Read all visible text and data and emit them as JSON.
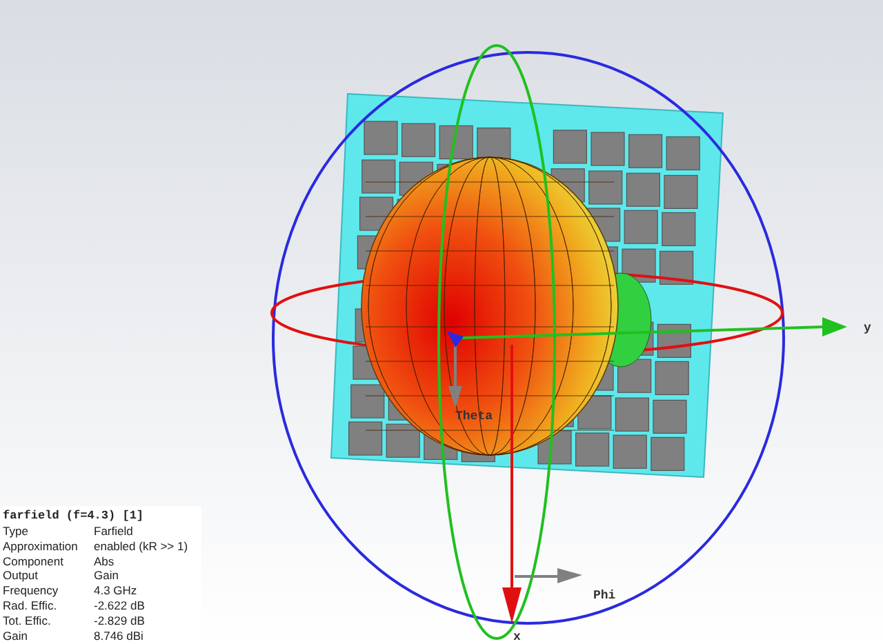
{
  "scene": {
    "axis_labels": [
      {
        "kind": "y",
        "text": "y"
      },
      {
        "kind": "x",
        "text": "x"
      },
      {
        "kind": "theta",
        "text": "Theta"
      },
      {
        "kind": "phi",
        "text": "Phi"
      }
    ]
  },
  "info_panel": {
    "title": "farfield (f=4.3) [1]",
    "rows": [
      {
        "label": "Type",
        "value": "Farfield"
      },
      {
        "label": "Approximation",
        "value": "enabled (kR >> 1)"
      },
      {
        "label": "Component",
        "value": "Abs"
      },
      {
        "label": "Output",
        "value": "Gain"
      },
      {
        "label": "Frequency",
        "value": "4.3 GHz"
      },
      {
        "label": "Rad. Effic.",
        "value": "-2.622 dB"
      },
      {
        "label": "Tot. Effic.",
        "value": "-2.829 dB"
      },
      {
        "label": "Gain",
        "value": "8.746 dBi"
      }
    ]
  }
}
